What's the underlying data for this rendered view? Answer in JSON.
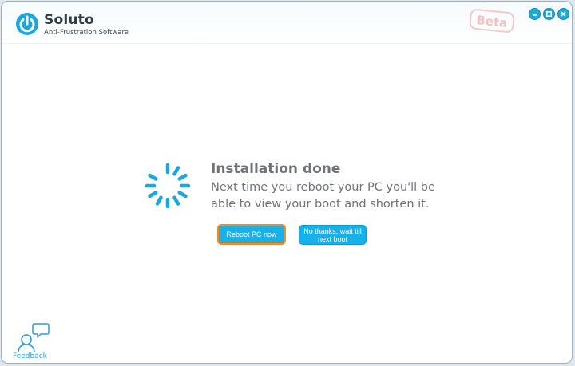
{
  "app": {
    "name": "Soluto",
    "tagline": "Anti-Frustration Software",
    "badge": "Beta"
  },
  "window_controls": [
    "minimize",
    "maximize",
    "close"
  ],
  "colors": {
    "accent": "#16b0ea",
    "focus_border": "#e8912b",
    "text_gray": "#6f7378",
    "beta_pink": "#f0c2c2"
  },
  "content": {
    "title": "Installation done",
    "message": "Next time you reboot your PC you'll be able to view your boot and shorten it."
  },
  "buttons": {
    "reboot_label": "Reboot PC now",
    "later_label": "No thanks, wait till next boot"
  },
  "feedback": {
    "label": "Feedback"
  },
  "icons": {
    "logo": "power-icon",
    "spinner": "loading-spinner-icon",
    "feedback": "feedback-person-bubble-icon"
  }
}
